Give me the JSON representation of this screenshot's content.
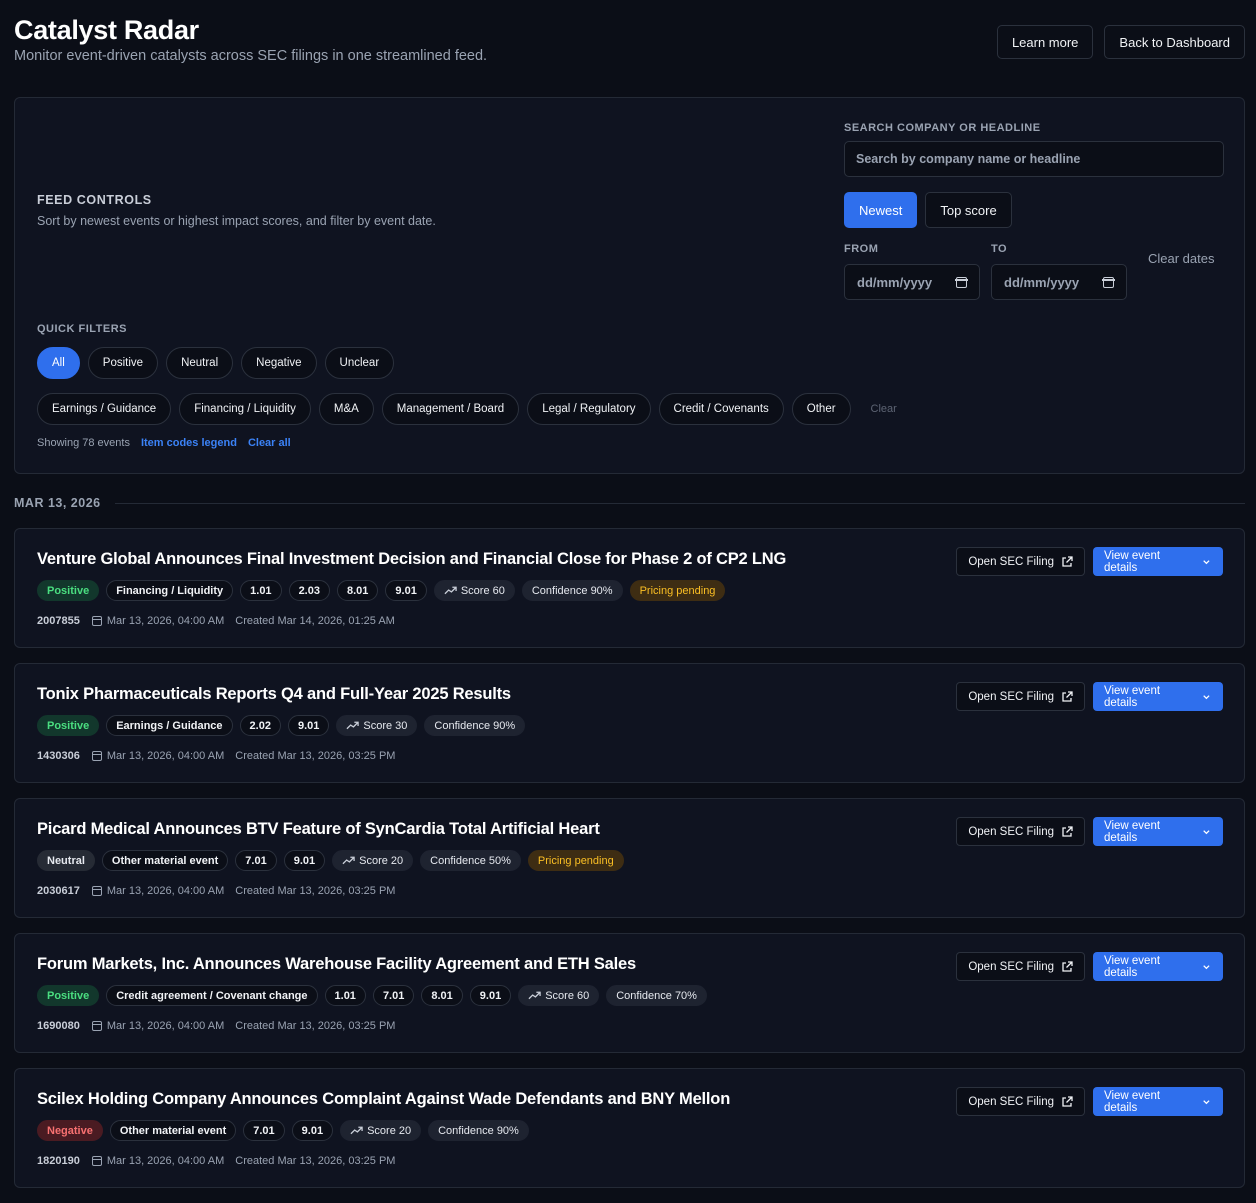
{
  "header": {
    "title": "Catalyst Radar",
    "subtitle": "Monitor event-driven catalysts across SEC filings in one streamlined feed.",
    "learn_more": "Learn more",
    "back": "Back to Dashboard"
  },
  "controls": {
    "title": "FEED CONTROLS",
    "description": "Sort by newest events or highest impact scores, and filter by event date.",
    "search_label": "SEARCH COMPANY OR HEADLINE",
    "search_placeholder": "Search by company name or headline",
    "sort_newest": "Newest",
    "sort_top": "Top score",
    "from_label": "FROM",
    "to_label": "TO",
    "from_value": "dd/mm/yyyy",
    "to_value": "dd/mm/yyyy",
    "clear_dates": "Clear dates",
    "quick_filters_label": "QUICK FILTERS",
    "sentiment_filters": [
      "All",
      "Positive",
      "Neutral",
      "Negative",
      "Unclear"
    ],
    "category_filters": [
      "Earnings / Guidance",
      "Financing / Liquidity",
      "M&A",
      "Management / Board",
      "Legal / Regulatory",
      "Credit / Covenants",
      "Other"
    ],
    "clear": "Clear",
    "showing": "Showing 78 events",
    "legend_link": "Item codes legend",
    "clear_all": "Clear all"
  },
  "feed": {
    "date_heading": "MAR 13, 2026",
    "open_sec": "Open SEC Filing",
    "view_details": "View event details",
    "events": [
      {
        "title": "Venture Global Announces Final Investment Decision and Financial Close for Phase 2 of CP2 LNG",
        "sentiment": "Positive",
        "category": "Financing / Liquidity",
        "codes": [
          "1.01",
          "2.03",
          "8.01",
          "9.01"
        ],
        "score": "Score 60",
        "confidence": "Confidence 90%",
        "pricing": "Pricing pending",
        "id": "2007855",
        "event_date": "Mar 13, 2026, 04:00 AM",
        "created": "Created Mar 14, 2026, 01:25 AM"
      },
      {
        "title": "Tonix Pharmaceuticals Reports Q4 and Full-Year 2025 Results",
        "sentiment": "Positive",
        "category": "Earnings / Guidance",
        "codes": [
          "2.02",
          "9.01"
        ],
        "score": "Score 30",
        "confidence": "Confidence 90%",
        "pricing": "",
        "id": "1430306",
        "event_date": "Mar 13, 2026, 04:00 AM",
        "created": "Created Mar 13, 2026, 03:25 PM"
      },
      {
        "title": "Picard Medical Announces BTV Feature of SynCardia Total Artificial Heart",
        "sentiment": "Neutral",
        "category": "Other material event",
        "codes": [
          "7.01",
          "9.01"
        ],
        "score": "Score 20",
        "confidence": "Confidence 50%",
        "pricing": "Pricing pending",
        "id": "2030617",
        "event_date": "Mar 13, 2026, 04:00 AM",
        "created": "Created Mar 13, 2026, 03:25 PM"
      },
      {
        "title": "Forum Markets, Inc. Announces Warehouse Facility Agreement and ETH Sales",
        "sentiment": "Positive",
        "category": "Credit agreement / Covenant change",
        "codes": [
          "1.01",
          "7.01",
          "8.01",
          "9.01"
        ],
        "score": "Score 60",
        "confidence": "Confidence 70%",
        "pricing": "",
        "id": "1690080",
        "event_date": "Mar 13, 2026, 04:00 AM",
        "created": "Created Mar 13, 2026, 03:25 PM"
      },
      {
        "title": "Scilex Holding Company Announces Complaint Against Wade Defendants and BNY Mellon",
        "sentiment": "Negative",
        "category": "Other material event",
        "codes": [
          "7.01",
          "9.01"
        ],
        "score": "Score 20",
        "confidence": "Confidence 90%",
        "pricing": "",
        "id": "1820190",
        "event_date": "Mar 13, 2026, 04:00 AM",
        "created": "Created Mar 13, 2026, 03:25 PM"
      }
    ]
  }
}
